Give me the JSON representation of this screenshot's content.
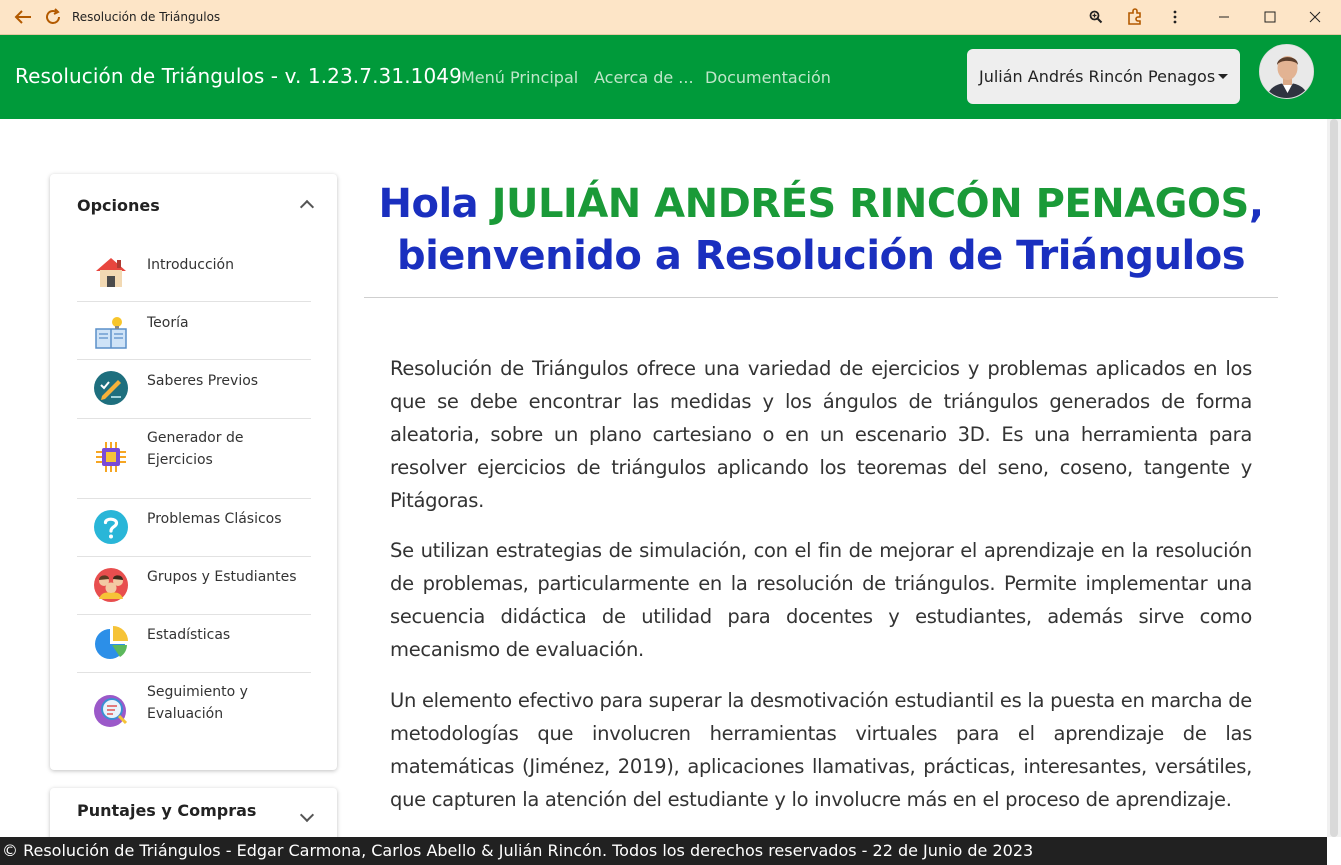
{
  "window": {
    "title": "Resolución de Triángulos"
  },
  "navbar": {
    "brand": "Resolución de Triángulos - v. 1.23.7.31.1049",
    "links": [
      "Menú Principal",
      "Acerca de ...",
      "Documentación"
    ],
    "user_name": "Julián Andrés Rincón Penagos"
  },
  "sidebar": {
    "title": "Opciones",
    "items": [
      {
        "label": "Introducción",
        "icon": "house-icon"
      },
      {
        "label": "Teoría",
        "icon": "book-lightbulb-icon"
      },
      {
        "label": "Saberes Previos",
        "icon": "pencil-check-icon"
      },
      {
        "label": "Generador de Ejercicios",
        "icon": "chip-icon"
      },
      {
        "label": "Problemas Clásicos",
        "icon": "question-icon"
      },
      {
        "label": "Grupos y Estudiantes",
        "icon": "group-icon"
      },
      {
        "label": "Estadísticas",
        "icon": "pie-chart-icon"
      },
      {
        "label": "Seguimiento y Evaluación",
        "icon": "magnifier-report-icon"
      }
    ],
    "second_card_title": "Puntajes y Compras"
  },
  "main": {
    "greeting_prefix": "Hola ",
    "greeting_name": "JULIÁN ANDRÉS RINCÓN PENAGOS",
    "greeting_suffix": ",",
    "greeting_line2": "bienvenido a Resolución de Triángulos",
    "paragraphs": [
      "Resolución de Triángulos ofrece una variedad de ejercicios y problemas aplicados en los que se debe encontrar las medidas y los ángulos de triángulos generados de forma aleatoria, sobre un plano cartesiano o en un escenario 3D. Es una herramienta para resolver ejercicios de triángulos aplicando los teoremas del seno, coseno, tangente y Pitágoras.",
      "Se utilizan estrategias de simulación, con el fin de mejorar el aprendizaje en la resolución de problemas, particularmente en la resolución de triángulos. Permite implementar una secuencia didáctica de utilidad para docentes y estudiantes, además sirve como mecanismo de evaluación.",
      "Un elemento efectivo para superar la desmotivación estudiantil es la puesta en marcha de metodologías que involucren herramientas virtuales para el aprendizaje de las matemáticas (Jiménez, 2019), aplicaciones llamativas, prácticas, interesantes, versátiles, que capturen la atención del estudiante y lo involucre más en el proceso de aprendizaje."
    ]
  },
  "footer": {
    "text": "© Resolución de Triángulos - Edgar Carmona, Carlos Abello & Julián Rincón. Todos los derechos reservados - 22 de Junio de 2023"
  },
  "colors": {
    "navbar": "#009a3a",
    "greeting_blue": "#1a2fbf",
    "greeting_green": "#1a9a38",
    "titlebar": "#fde5c7",
    "footer": "#212121"
  }
}
